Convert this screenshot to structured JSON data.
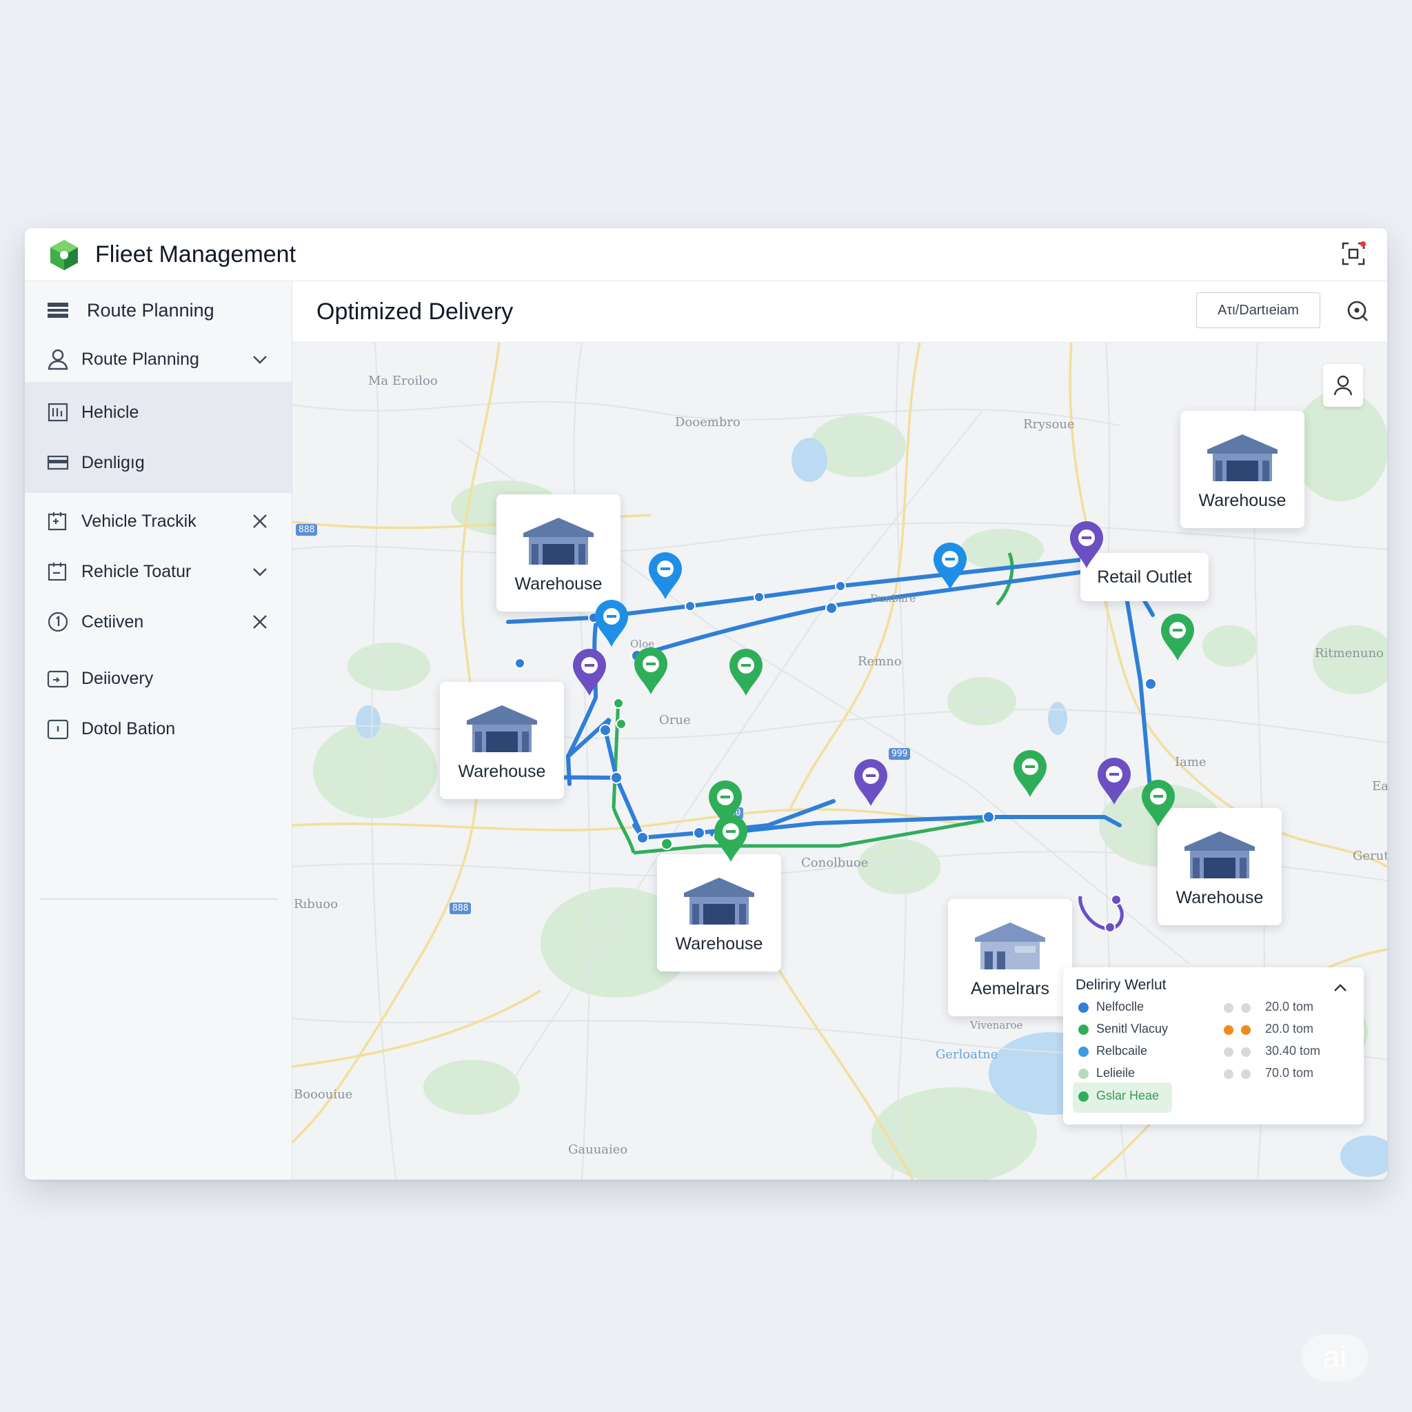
{
  "app": {
    "title": "Flieet Management"
  },
  "sidebar": {
    "items": [
      {
        "label": "Route Planning",
        "icon": "list-icon"
      },
      {
        "label": "Route Planning",
        "icon": "user-icon",
        "trail": "chevron-down-icon"
      },
      {
        "label": "Hehicle",
        "icon": "vehicle-icon"
      },
      {
        "label": "Denligıg",
        "icon": "card-icon"
      },
      {
        "label": "Vehicle Trackik",
        "icon": "tracking-icon",
        "trail": "close-icon"
      },
      {
        "label": "Rehicle Toatur",
        "icon": "tour-icon",
        "trail": "chevron-down-icon"
      },
      {
        "label": "Cetiiven",
        "icon": "info-circle-icon",
        "trail": "close-icon"
      },
      {
        "label": "Deiiovery",
        "icon": "delivery-icon"
      },
      {
        "label": "Dotol Bation",
        "icon": "station-icon"
      }
    ]
  },
  "main": {
    "title": "Optimized Delivery",
    "header_button": "Ατι/Dartıeiam"
  },
  "map": {
    "place_labels": [
      "Ma Eroiloo",
      "Dooembro",
      "Rrysoue",
      "Ritmenuno",
      "Remno",
      "Orue",
      "Iame",
      "Conolbuoe",
      "Rıbuoo",
      "Booouiue",
      "Gauuaieo",
      "Gerut",
      "Eas",
      "Gerloatne",
      "Vivenaroe",
      "Oloe",
      "Dunbare"
    ],
    "road_shields": [
      "888",
      "999",
      "800",
      "888"
    ],
    "cards": [
      {
        "label": "Warehouse"
      },
      {
        "label": "Warehouse"
      },
      {
        "label": "Warehouse"
      },
      {
        "label": "Warehouse"
      },
      {
        "label": "Warehouse"
      },
      {
        "label": "Aemelrars"
      }
    ],
    "retail_outlet": "Retail Outlet"
  },
  "legend": {
    "title": "Deliriry Werlut",
    "rows": [
      {
        "name": "Nelfoclle",
        "color": "#2f7fd6",
        "d1": "#d6d9de",
        "d2": "#d6d9de",
        "value": "20.0 tom"
      },
      {
        "name": "Senitl Vlacuy",
        "color": "#2fae5a",
        "d1": "#f08a1c",
        "d2": "#f08a1c",
        "value": "20.0 tom"
      },
      {
        "name": "Relbcaile",
        "color": "#3a9ce0",
        "d1": "#d6d9de",
        "d2": "#d6d9de",
        "value": "30.40 tom"
      },
      {
        "name": "Lelieile",
        "color": "#b9d9be",
        "d1": "#d6d9de",
        "d2": "#d6d9de",
        "value": "70.0 tom"
      },
      {
        "name": "Gslar Heae",
        "color": "#2fae5a"
      }
    ]
  },
  "colors": {
    "route_blue": "#2f7fd6",
    "route_green": "#2fae5a",
    "route_purple": "#6c4fc2",
    "pin_blue": "#1e8fe6"
  },
  "badge": "ai"
}
